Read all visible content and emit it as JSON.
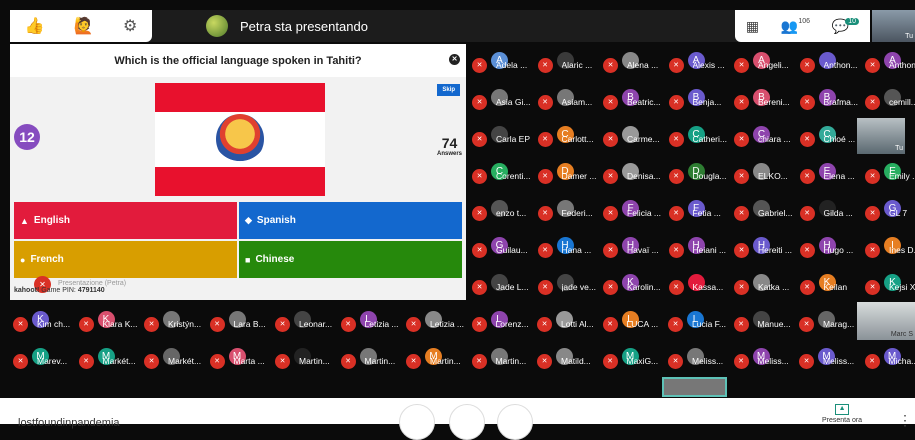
{
  "topbar": {
    "presenting": "Petra sta presentando",
    "participants": "106",
    "chat": "10",
    "self_label": "Tu"
  },
  "kahoot": {
    "question": "Which is the official language spoken in Tahiti?",
    "timer": "12",
    "answers_count": "74",
    "answers_label": "Answers",
    "skip": "Skip",
    "options": [
      "English",
      "Spanish",
      "French",
      "Chinese"
    ],
    "pin_brand": "kahoot!",
    "pin_label": "Game PIN:",
    "pin": "4791140",
    "presenter_overlay": "Presentazione (Petra)"
  },
  "grid": [
    [
      {
        "n": "Adela ...",
        "c": "#5b8fd6",
        "i": "A"
      },
      {
        "n": "Alaric ...",
        "c": "#3a3a3a",
        "i": ""
      },
      {
        "n": "Alena ...",
        "c": "#888",
        "i": ""
      },
      {
        "n": "Alexis ...",
        "c": "#6a5acd",
        "i": "A"
      },
      {
        "n": "Angeli...",
        "c": "#d84f6e",
        "i": "A"
      },
      {
        "n": "Anthon...",
        "c": "#6a5acd",
        "i": ""
      },
      {
        "n": "Anthon",
        "c": "#8e44ad",
        "i": "A"
      }
    ],
    [
      {
        "n": "Asia Gi...",
        "c": "#777",
        "i": ""
      },
      {
        "n": "Asiam...",
        "c": "#777",
        "i": ""
      },
      {
        "n": "Beatric...",
        "c": "#8e44ad",
        "i": "B"
      },
      {
        "n": "Benja...",
        "c": "#6a5acd",
        "i": "B"
      },
      {
        "n": "Bereni...",
        "c": "#d84f6e",
        "i": "B"
      },
      {
        "n": "Brafma...",
        "c": "#8e44ad",
        "i": "B"
      },
      {
        "n": "cemill...",
        "c": "#555",
        "i": ""
      }
    ],
    [
      {
        "n": "Carla EP",
        "c": "#444",
        "i": ""
      },
      {
        "n": "Carlott...",
        "c": "#e67e22",
        "i": "C"
      },
      {
        "n": "Carme...",
        "c": "#999",
        "i": ""
      },
      {
        "n": "Catheri...",
        "c": "#16a085",
        "i": "C"
      },
      {
        "n": "chiara ...",
        "c": "#8e44ad",
        "i": "C"
      },
      {
        "n": "Chloé ...",
        "c": "#3a9",
        "i": "C"
      },
      {
        "n": "Tu",
        "c": "#666",
        "i": ""
      }
    ],
    [
      {
        "n": "Corenti...",
        "c": "#27ae60",
        "i": "C"
      },
      {
        "n": "Damer ...",
        "c": "#e67e22",
        "i": "D"
      },
      {
        "n": "Denisa...",
        "c": "#999",
        "i": ""
      },
      {
        "n": "Dougla...",
        "c": "#2e7d32",
        "i": "D"
      },
      {
        "n": "ELKO...",
        "c": "#888",
        "i": ""
      },
      {
        "n": "Elena ...",
        "c": "#8e44ad",
        "i": "E"
      },
      {
        "n": "Emily ...",
        "c": "#27ae60",
        "i": "E"
      }
    ],
    [
      {
        "n": "enzo t...",
        "c": "#555",
        "i": ""
      },
      {
        "n": "Federi...",
        "c": "#777",
        "i": ""
      },
      {
        "n": "Felicia ...",
        "c": "#8e44ad",
        "i": "F"
      },
      {
        "n": "Fetia ...",
        "c": "#6a5acd",
        "i": "F"
      },
      {
        "n": "Gabriel...",
        "c": "#555",
        "i": ""
      },
      {
        "n": "Gilda ...",
        "c": "#222",
        "i": ""
      },
      {
        "n": "GL 7",
        "c": "#6a5acd",
        "i": "G"
      }
    ],
    [
      {
        "n": "Guilau...",
        "c": "#8e44ad",
        "i": "G"
      },
      {
        "n": "Hana ...",
        "c": "#1976d2",
        "i": "H"
      },
      {
        "n": "Havaï ...",
        "c": "#8e44ad",
        "i": "H"
      },
      {
        "n": "Heiani ...",
        "c": "#8e44ad",
        "i": "H"
      },
      {
        "n": "Hereiti ...",
        "c": "#6a5acd",
        "i": "H"
      },
      {
        "n": "Hugo ...",
        "c": "#8e44ad",
        "i": "H"
      },
      {
        "n": "Ines D...",
        "c": "#e67e22",
        "i": "I"
      }
    ],
    [
      {
        "n": "Jade L...",
        "c": "#444",
        "i": ""
      },
      {
        "n": "jade ve...",
        "c": "#444",
        "i": ""
      },
      {
        "n": "Karolin...",
        "c": "#8e44ad",
        "i": "K"
      },
      {
        "n": "Kassa...",
        "c": "#e21b3c",
        "i": ""
      },
      {
        "n": "Katka ...",
        "c": "#888",
        "i": ""
      },
      {
        "n": "Keilan",
        "c": "#e67e22",
        "i": "K"
      },
      {
        "n": "Kejsi X",
        "c": "#16a085",
        "i": "K"
      }
    ],
    [
      {
        "n": "Kim ch...",
        "c": "#6a5acd",
        "i": "K"
      },
      {
        "n": "Klara K...",
        "c": "#d84f6e",
        "i": "K"
      },
      {
        "n": "Kristýn...",
        "c": "#777",
        "i": ""
      },
      {
        "n": "Lara B...",
        "c": "#777",
        "i": ""
      },
      {
        "n": "Leonar...",
        "c": "#444",
        "i": ""
      },
      {
        "n": "Letizia ...",
        "c": "#8e44ad",
        "i": "L"
      },
      {
        "n": "Letizia ...",
        "c": "#888",
        "i": ""
      },
      {
        "n": "Lorenz...",
        "c": "#8e44ad",
        "i": "L"
      },
      {
        "n": "Lotti Al...",
        "c": "#999",
        "i": ""
      },
      {
        "n": "LUCA ...",
        "c": "#e67e22",
        "i": "L"
      },
      {
        "n": "Lucia F...",
        "c": "#1976d2",
        "i": "L"
      },
      {
        "n": "Manue...",
        "c": "#444",
        "i": ""
      },
      {
        "n": "Marag...",
        "c": "#666",
        "i": ""
      },
      {
        "n": "Marc S",
        "c": "#777",
        "i": ""
      }
    ],
    [
      {
        "n": "Marev...",
        "c": "#16a085",
        "i": "M"
      },
      {
        "n": "Markét...",
        "c": "#16a085",
        "i": "M"
      },
      {
        "n": "Markét...",
        "c": "#666",
        "i": ""
      },
      {
        "n": "Marta ...",
        "c": "#d84f6e",
        "i": "M"
      },
      {
        "n": "Martin...",
        "c": "#222",
        "i": ""
      },
      {
        "n": "Martin...",
        "c": "#777",
        "i": ""
      },
      {
        "n": "Martin...",
        "c": "#e67e22",
        "i": "M"
      },
      {
        "n": "Martin...",
        "c": "#777",
        "i": ""
      },
      {
        "n": "Matild...",
        "c": "#888",
        "i": ""
      },
      {
        "n": "MaxiG...",
        "c": "#16a085",
        "i": "M"
      },
      {
        "n": "Meliss...",
        "c": "#777",
        "i": ""
      },
      {
        "n": "Meliss...",
        "c": "#8e44ad",
        "i": "M"
      },
      {
        "n": "Meliss...",
        "c": "#6a5acd",
        "i": "M"
      },
      {
        "n": "Micha...",
        "c": "#6a5acd",
        "i": "M"
      }
    ]
  ],
  "bottom": {
    "meeting": "lostfoundinpandemia",
    "present": "Presenta ora"
  }
}
